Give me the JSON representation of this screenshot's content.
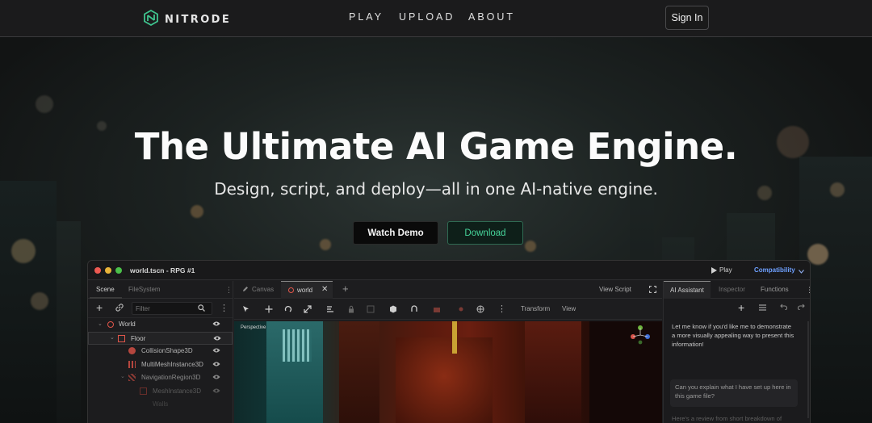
{
  "nav": {
    "brand": "NITRODE",
    "links": [
      "PLAY",
      "UPLOAD",
      "ABOUT"
    ],
    "signin_label": "Sign In"
  },
  "hero": {
    "title": "The Ultimate AI Game Engine.",
    "subtitle": "Design, script, and deploy—all in one AI-native engine.",
    "watch_demo_label": "Watch Demo",
    "download_label": "Download"
  },
  "editor": {
    "window_title": "world.tscn - RPG #1",
    "play_label": "Play",
    "compat_label": "Compatibility",
    "left_tabs": [
      "Scene",
      "FileSystem"
    ],
    "filter_placeholder": "Filter",
    "tree": [
      {
        "label": "World",
        "depth": 0,
        "color": "#c8c8c8"
      },
      {
        "label": "Floor",
        "depth": 1,
        "color": "#c8c8c8"
      },
      {
        "label": "CollisionShape3D",
        "depth": 2,
        "color": "#b0b0b0"
      },
      {
        "label": "MultiMeshInstance3D",
        "depth": 2,
        "color": "#b0b0b0"
      },
      {
        "label": "NavigationRegion3D",
        "depth": 2,
        "color": "#8a8a8a"
      },
      {
        "label": "MeshInstance3D",
        "depth": 3,
        "color": "#5a5a5a"
      },
      {
        "label": "Walls",
        "depth": 2,
        "color": "#444444"
      }
    ],
    "view_tabs": {
      "canvas": "Canvas",
      "world": "world",
      "view_script": "View Script"
    },
    "toolbar": {
      "transform": "Transform",
      "view": "View"
    },
    "viewport_label": "Perspective",
    "right_tabs": [
      "AI Assistant",
      "Inspector",
      "Functions"
    ],
    "chat": {
      "assistant_msg": "Let me know if you'd like me to demonstrate a more visually appealing way to present this information!",
      "user_msg": "Can you explain what I have set up here in this game file?",
      "assistant_reply": "Here's a review from short breakdown of your project setup:"
    },
    "colors": {
      "accent_green": "#46d49a",
      "compat_blue": "#6ea0ff",
      "node_red": "#e0554a"
    }
  }
}
